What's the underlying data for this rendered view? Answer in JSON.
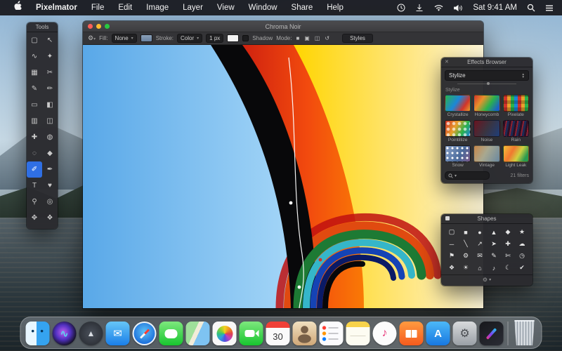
{
  "menu_bar": {
    "app_name": "Pixelmator",
    "menus": [
      "File",
      "Edit",
      "Image",
      "Layer",
      "View",
      "Window",
      "Share",
      "Help"
    ],
    "clock": "Sat 9:41 AM"
  },
  "tools_panel": {
    "title": "Tools",
    "glyphs": [
      "▢",
      "↖",
      "∿",
      "✦",
      "▦",
      "✂",
      "✎",
      "✏",
      "▭",
      "◧",
      "▥",
      "◫",
      "✚",
      "◍",
      "◌",
      "◆",
      "✐",
      "✒",
      "T",
      "♥",
      "⚲",
      "◎",
      "✥",
      "❖"
    ]
  },
  "document_window": {
    "title": "Chroma Noir",
    "toolbar": {
      "fill_label": "Fill:",
      "fill_value": "None",
      "stroke_label": "Stroke:",
      "stroke_value": "Color",
      "stroke_width": "1 px",
      "shadow_label": "Shadow",
      "mode_label": "Mode:",
      "mode_glyphs": [
        "■",
        "▣",
        "◫",
        "↺"
      ],
      "styles_button": "Styles"
    }
  },
  "effects_browser": {
    "title": "Effects Browser",
    "category_dropdown": "Stylize",
    "section_label": "Stylize",
    "effects": [
      "Crystallize",
      "Honeycomb",
      "Pixelate",
      "Pointillize",
      "Noise",
      "Rain",
      "Snow",
      "Vintage",
      "Light Leak"
    ],
    "filter_count": "21 filters"
  },
  "shapes_panel": {
    "title": "Shapes",
    "glyphs": [
      "▢",
      "■",
      "●",
      "▲",
      "◆",
      "★",
      "─",
      "╲",
      "↗",
      "➤",
      "✚",
      "☁",
      "⚑",
      "⚙",
      "✉",
      "✎",
      "✄",
      "◷",
      "❖",
      "☀",
      "⌂",
      "♪",
      "☾",
      "✔"
    ]
  },
  "dock": {
    "calendar_day": "30",
    "icon_names": [
      "finder",
      "siri",
      "launchpad",
      "mail",
      "safari",
      "messages",
      "maps",
      "photos",
      "facetime",
      "calendar",
      "contacts",
      "reminders",
      "notes",
      "itunes",
      "ibooks",
      "app-store",
      "system-preferences",
      "pixelmator",
      "trash"
    ]
  },
  "colors": {
    "selection_blue": "#2f6fe4",
    "menubar_bg": "#16161a"
  }
}
